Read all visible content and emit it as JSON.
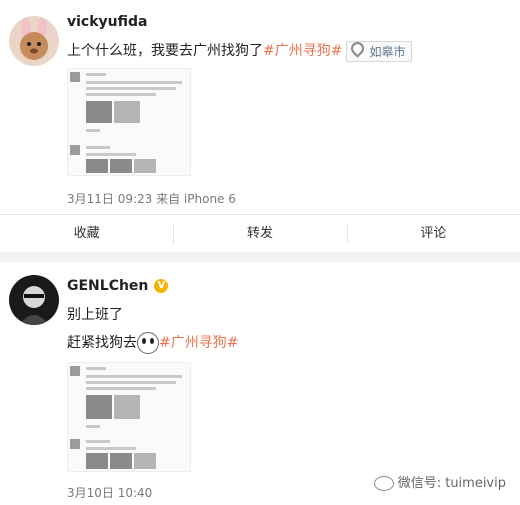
{
  "post1": {
    "username": "vickyufida",
    "text": "上个什么班，我要去广州找狗了",
    "hashtag": "#广州寻狗#",
    "location": "如皋市",
    "meta": "3月11日 09:23 来自 iPhone 6",
    "actions": {
      "favorite": "收藏",
      "repost": "转发",
      "comment": "评论"
    }
  },
  "post2": {
    "username": "GENLChen",
    "verified": "V",
    "line1": "别上班了",
    "line2": "赶紧找狗去",
    "hashtag": "#广州寻狗#",
    "meta": "3月10日 10:40"
  },
  "watermark": "微信号: tuimeivip",
  "colors": {
    "hashtag": "#eb7350",
    "location_text": "#5d7895",
    "verified_badge": "#f5b400"
  },
  "icons": [
    "location-pin-icon",
    "verified-badge-icon",
    "emoji-icon",
    "wechat-icon"
  ]
}
